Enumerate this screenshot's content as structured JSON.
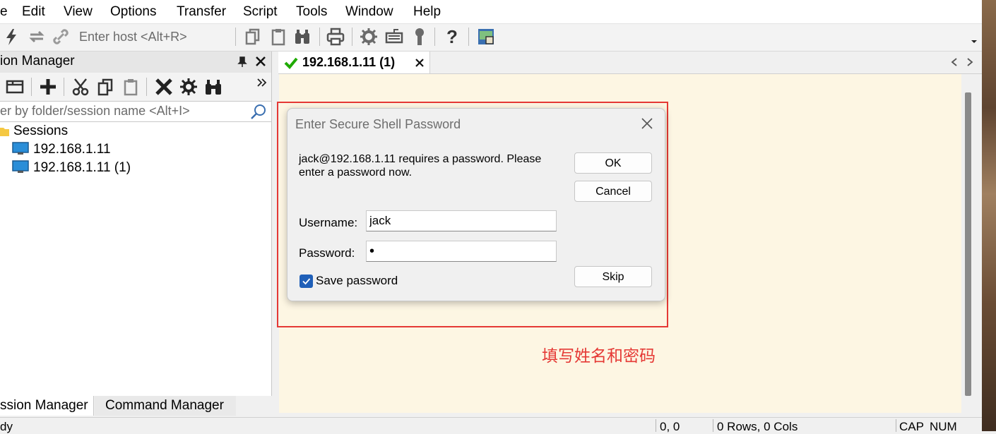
{
  "menu": [
    "e",
    "Edit",
    "View",
    "Options",
    "Transfer",
    "Script",
    "Tools",
    "Window",
    "Help"
  ],
  "toolbar": {
    "host_placeholder": "Enter host <Alt+R>",
    "icons": [
      "lightning-icon",
      "reconnect-icon",
      "link-icon",
      "copy-icon",
      "paste-icon",
      "find-icon",
      "print-icon",
      "settings-icon",
      "keymap-icon",
      "key-icon",
      "help-icon",
      "sftp-icon",
      "overflow-icon"
    ]
  },
  "session_manager": {
    "title": "ion Manager",
    "filter_placeholder": "er by folder/session name <Alt+I>",
    "tree": {
      "root": "Sessions",
      "items": [
        "192.168.1.11",
        "192.168.1.11 (1)"
      ]
    }
  },
  "bottom_tabs": [
    "ssion Manager",
    "Command Manager"
  ],
  "session_tab": {
    "label": "192.168.1.11 (1)",
    "status_color": "#1faa00"
  },
  "dialog": {
    "title": "Enter Secure Shell Password",
    "message": "jack@192.168.1.11 requires a password.  Please enter a password now.",
    "username_label": "Username:",
    "username_value": "jack",
    "password_label": "Password:",
    "password_mask": "•",
    "save_password_label": "Save password",
    "save_password_checked": true,
    "ok_label": "OK",
    "cancel_label": "Cancel",
    "skip_label": "Skip"
  },
  "annotation": {
    "text": "填写姓名和密码",
    "color": "#e53935"
  },
  "statusbar": {
    "left": "dy",
    "position": "0, 0",
    "size": "0 Rows, 0 Cols",
    "cap": "CAP",
    "num": "NUM"
  },
  "colors": {
    "terminal_bg": "#fdf6e3",
    "highlight": "#e53935",
    "check_blue": "#1f5fb8"
  }
}
